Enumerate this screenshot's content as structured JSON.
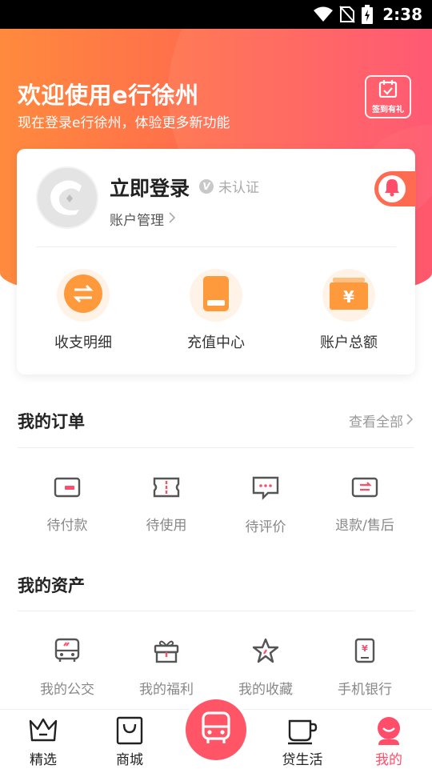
{
  "status_bar": {
    "time": "2:38"
  },
  "header": {
    "title": "欢迎使用e行徐州",
    "subtitle": "现在登录e行徐州，体验更多新功能",
    "checkin_label": "签到有礼"
  },
  "account": {
    "login_label": "立即登录",
    "verify_status": "未认证",
    "manage_label": "账户管理",
    "quick_actions": [
      {
        "label": "收支明细",
        "icon": "transfer-icon"
      },
      {
        "label": "充值中心",
        "icon": "card-icon"
      },
      {
        "label": "账户总额",
        "icon": "wallet-icon"
      }
    ]
  },
  "orders": {
    "title": "我的订单",
    "view_all": "查看全部",
    "items": [
      {
        "label": "待付款",
        "icon": "wallet-card-icon"
      },
      {
        "label": "待使用",
        "icon": "ticket-icon"
      },
      {
        "label": "待评价",
        "icon": "comment-icon"
      },
      {
        "label": "退款/售后",
        "icon": "refund-icon"
      }
    ]
  },
  "assets": {
    "title": "我的资产",
    "items": [
      {
        "label": "我的公交",
        "icon": "bus-icon"
      },
      {
        "label": "我的福利",
        "icon": "gift-icon"
      },
      {
        "label": "我的收藏",
        "icon": "star-icon"
      },
      {
        "label": "手机银行",
        "icon": "phone-bank-icon"
      }
    ]
  },
  "bottom_nav": {
    "items": [
      {
        "label": "精选",
        "icon": "crown-icon"
      },
      {
        "label": "商城",
        "icon": "shopping-bag-icon"
      },
      {
        "label": "",
        "icon": "bus-icon"
      },
      {
        "label": "贷生活",
        "icon": "coffee-cup-icon"
      },
      {
        "label": "我的",
        "icon": "profile-icon"
      }
    ],
    "active_index": 4
  },
  "colors": {
    "accent": "#ff4d6a",
    "header_gradient_start": "#ff8a3d",
    "header_gradient_end": "#ff4d6a",
    "quick_icon": "#ff9a3c",
    "order_icon_accent": "#ff4d6a",
    "icon_gray": "#555555"
  }
}
